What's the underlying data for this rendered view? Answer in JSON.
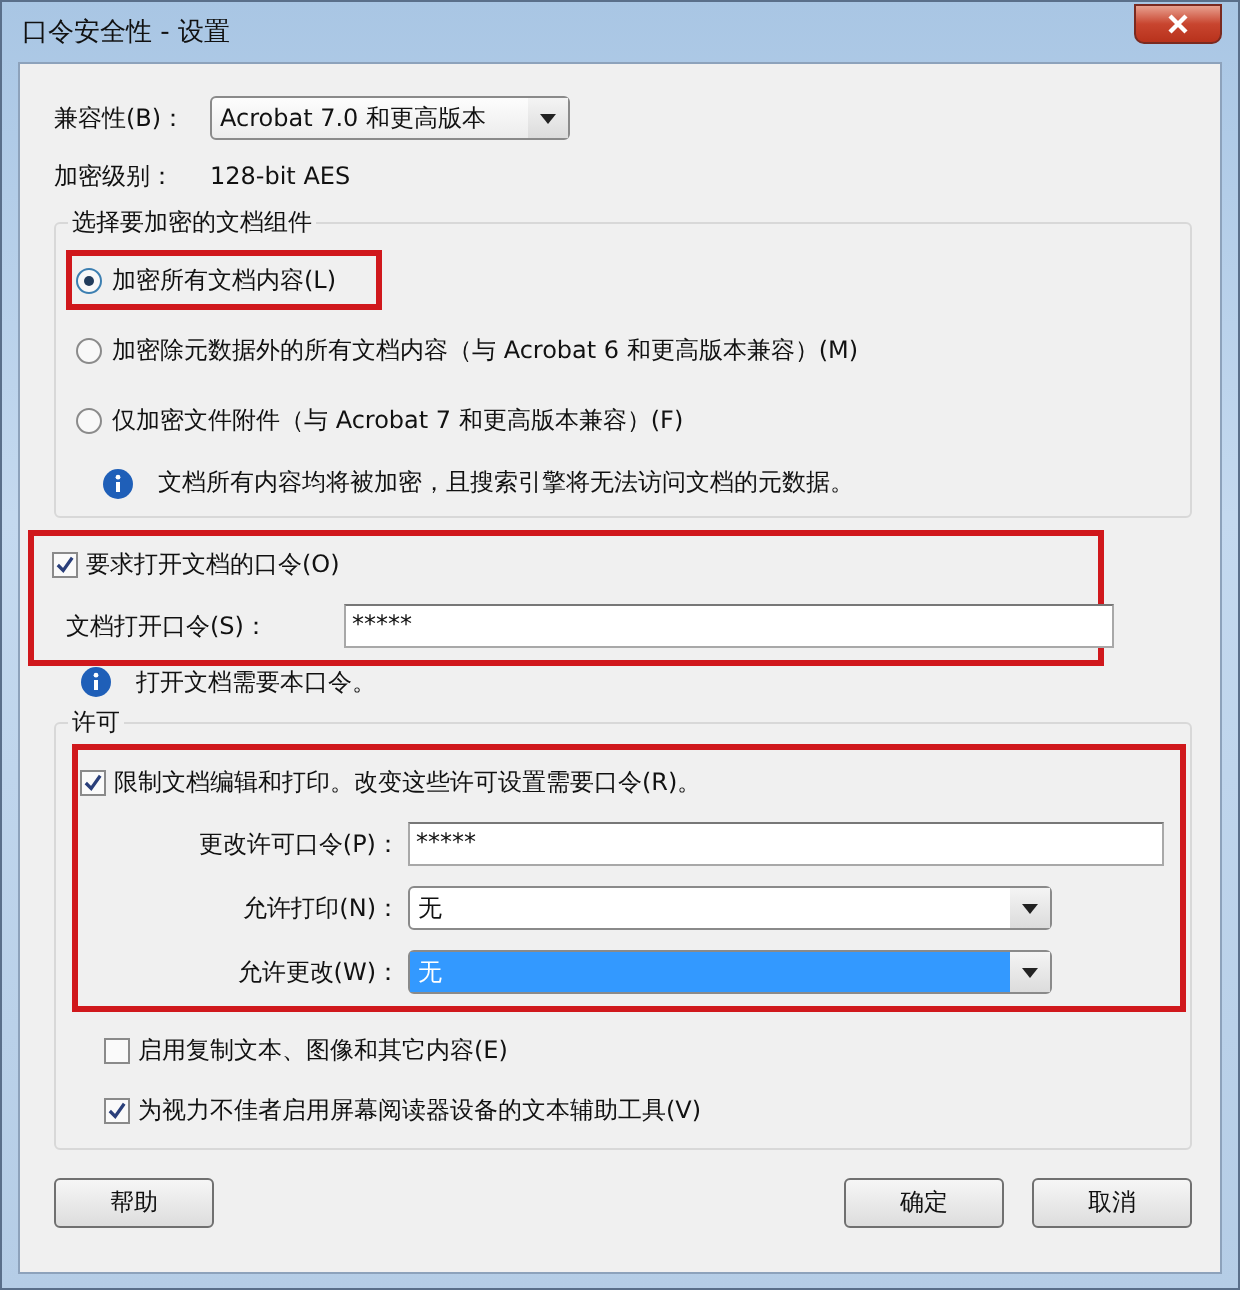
{
  "window": {
    "title": "口令安全性 - 设置"
  },
  "compatibility": {
    "label": "兼容性(B)：",
    "value": "Acrobat 7.0 和更高版本"
  },
  "encryption_level": {
    "label": "加密级别：",
    "value": "128-bit AES"
  },
  "components": {
    "title": "选择要加密的文档组件",
    "options": [
      {
        "label": "加密所有文档内容(L)",
        "selected": true
      },
      {
        "label": "加密除元数据外的所有文档内容（与 Acrobat 6 和更高版本兼容）(M)",
        "selected": false
      },
      {
        "label": "仅加密文件附件（与 Acrobat 7 和更高版本兼容）(F)",
        "selected": false
      }
    ],
    "note": "文档所有内容均将被加密，且搜索引擎将无法访问文档的元数据。"
  },
  "open_password": {
    "label": "要求打开文档的口令(O)",
    "checked": true,
    "field_label": "文档打开口令(S)：",
    "value": "*****",
    "note": "打开文档需要本口令。"
  },
  "permissions": {
    "title": "许可",
    "restrict": {
      "label": "限制文档编辑和打印。改变这些许可设置需要口令(R)。",
      "checked": true
    },
    "password_label": "更改许可口令(P)：",
    "password": "*****",
    "dropdowns": [
      {
        "label": "允许打印(N)：",
        "value": "无",
        "selected": false
      },
      {
        "label": "允许更改(W)：",
        "value": "无",
        "selected": true
      }
    ],
    "options": [
      {
        "label": "启用复制文本、图像和其它内容(E)",
        "checked": false
      },
      {
        "label": "为视力不佳者启用屏幕阅读器设备的文本辅助工具(V)",
        "checked": true
      }
    ]
  },
  "buttons": {
    "help": "帮助",
    "ok": "确定",
    "cancel": "取消"
  }
}
